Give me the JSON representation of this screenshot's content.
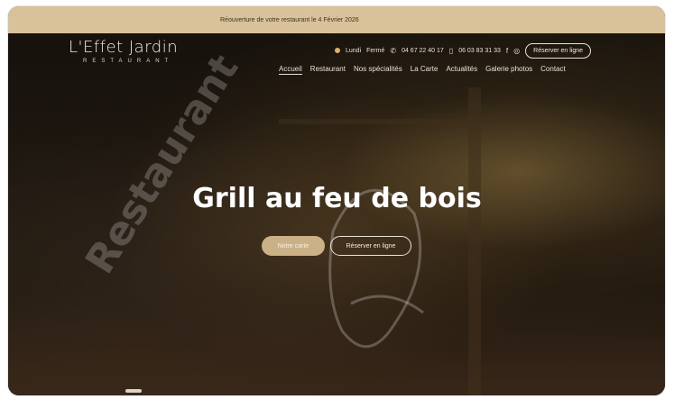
{
  "announcement": "Réouverture de votre restaurant le 4 Février 2026",
  "logo": {
    "name": "L'Effet Jardin",
    "sub": "RESTAURANT"
  },
  "contact": {
    "day": "Lundi",
    "status": "Fermé",
    "phone1": "04 67 22 40 17",
    "phone2": "06 03 83 31 33",
    "reserve_label": "Réserver en ligne"
  },
  "nav": {
    "items": [
      "Accueil",
      "Restaurant",
      "Nos spécialités",
      "La Carte",
      "Actualités",
      "Galerie photos",
      "Contact"
    ],
    "active": "Accueil"
  },
  "hero": {
    "title": "Grill au feu de bois",
    "btn_menu": "Notre carte",
    "btn_reserve": "Réserver en ligne"
  },
  "watermark": {
    "text": "Restaurant Effet Jardin Grill"
  },
  "colors": {
    "announce_bg": "#d9c29a",
    "accent_gold": "#cbb187",
    "status_dot": "#d8b46a"
  },
  "icons": {
    "phone": "phone-icon",
    "mobile": "mobile-icon",
    "facebook": "facebook-icon",
    "instagram": "instagram-icon",
    "status": "status-dot-icon"
  }
}
